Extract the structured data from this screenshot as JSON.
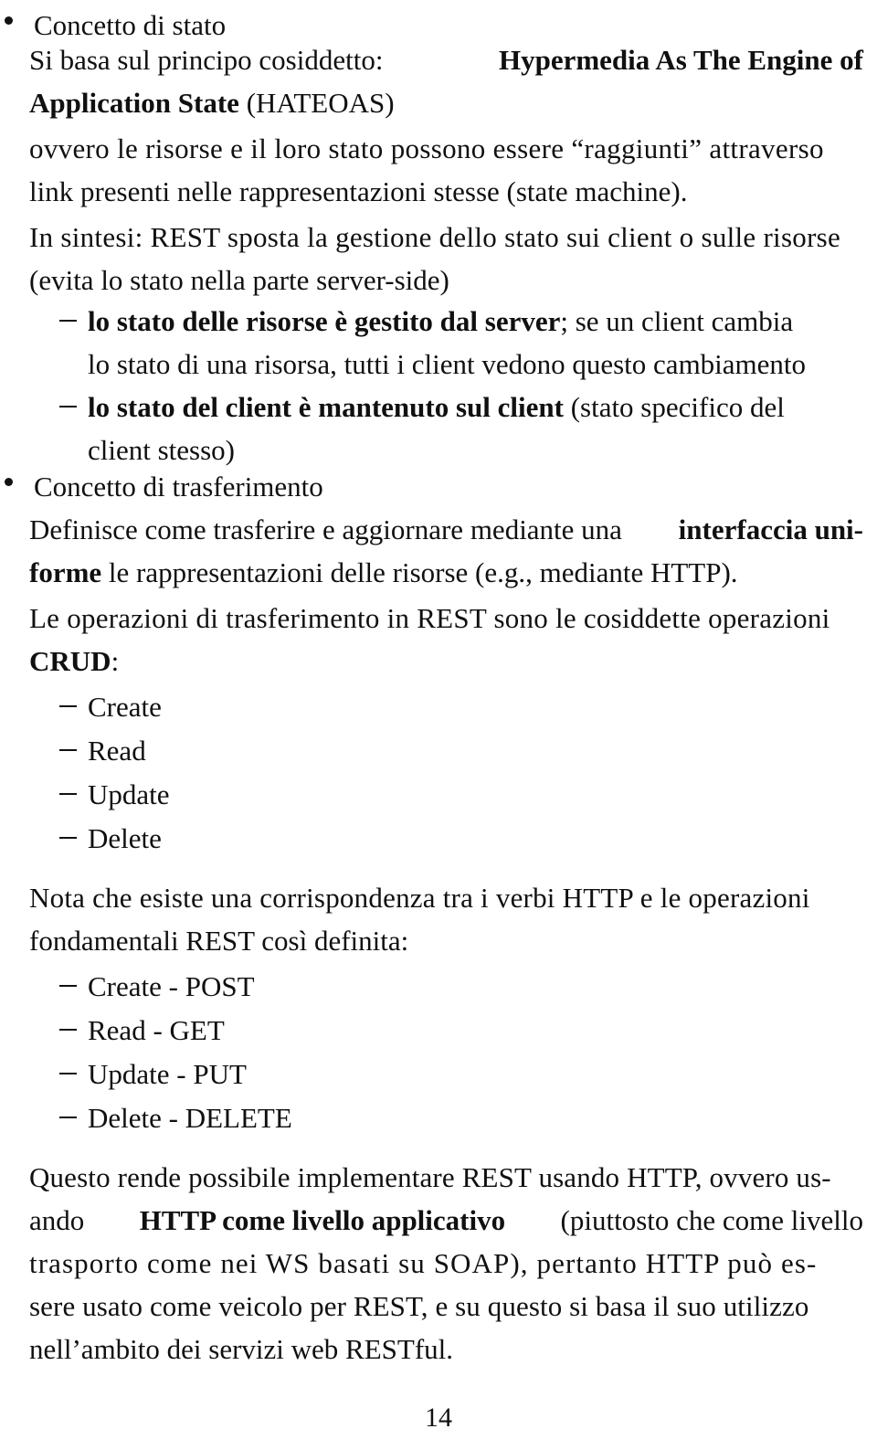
{
  "document": {
    "language": "it",
    "page_number": "14",
    "topic": "REST — Concetto di stato e Concetto di trasferimento"
  },
  "sections": [
    {
      "id": "concetto-di-stato",
      "bullet_label": "Concetto di stato",
      "lines": [
        {
          "id": "s1l1",
          "plain_a": "Si basa sul principo cosiddetto: ",
          "bold_b": "Hypermedia As The Engine of"
        },
        {
          "id": "s1l2",
          "bold_a": "Application State",
          "plain_b": " (HATEOAS)"
        }
      ],
      "paragraph2": [
        {
          "id": "s1p2l1",
          "text": "ovvero le risorse e il loro stato possono essere “raggiunti” attraverso"
        },
        {
          "id": "s1p2l2",
          "text": "link presenti nelle rappresentazioni stesse (state machine)."
        }
      ],
      "paragraph3": [
        {
          "id": "s1p3l1",
          "text": "In sintesi: REST sposta la gestione dello stato sui client o sulle risorse"
        },
        {
          "id": "s1p3l2",
          "text": "(evita lo stato nella parte server-side)"
        }
      ],
      "dash_items": [
        {
          "id": "d1",
          "line1_bold": "lo stato delle risorse è gestito dal server",
          "line1_plain": "; se un client cambia",
          "line2": "lo stato di una risorsa, tutti i client vedono questo cambiamento"
        },
        {
          "id": "d2",
          "line1_bold": "lo stato del client è mantenuto sul client",
          "line1_plain": " (stato specifico del",
          "line2": "client stesso)"
        }
      ]
    },
    {
      "id": "concetto-di-trasferimento",
      "bullet_label": "Concetto di trasferimento",
      "lines": [
        {
          "id": "s2l1",
          "plain_a": "Definisce come trasferire e aggiornare mediante una ",
          "bold_b": "interfaccia uni-"
        },
        {
          "id": "s2l2",
          "bold_a": "forme",
          "plain_b": " le rappresentazioni delle risorse (e.g., mediante HTTP)."
        }
      ],
      "paragraph2": [
        {
          "id": "s2p2l1",
          "text": "Le operazioni di trasferimento in REST sono le cosiddette operazioni"
        },
        {
          "id": "s2p2l2_bold",
          "text": "CRUD",
          "suffix": ":"
        }
      ],
      "crud_list": [
        {
          "id": "crud-create",
          "label": "Create"
        },
        {
          "id": "crud-read",
          "label": "Read"
        },
        {
          "id": "crud-update",
          "label": "Update"
        },
        {
          "id": "crud-delete",
          "label": "Delete"
        }
      ],
      "paragraph3": [
        {
          "id": "s2p3l1",
          "text": "Nota che esiste una corrispondenza tra i verbi HTTP e le operazioni"
        },
        {
          "id": "s2p3l2",
          "text": "fondamentali REST così definita:"
        }
      ],
      "verb_map_list": [
        {
          "id": "map-create",
          "label": "Create - POST"
        },
        {
          "id": "map-read",
          "label": "Read - GET"
        },
        {
          "id": "map-update",
          "label": "Update - PUT"
        },
        {
          "id": "map-delete",
          "label": "Delete - DELETE"
        }
      ],
      "closing_paragraph": [
        {
          "id": "cp1",
          "text": "Questo rende possibile implementare REST usando HTTP, ovvero us-"
        },
        {
          "id": "cp2_a",
          "text": "ando "
        },
        {
          "id": "cp2_bold",
          "text": "HTTP come livello applicativo"
        },
        {
          "id": "cp2_b",
          "text": " (piuttosto che come livello"
        },
        {
          "id": "cp3",
          "text": "trasporto come nei WS basati su SOAP), pertanto HTTP può es-"
        },
        {
          "id": "cp4",
          "text": "sere usato come veicolo per REST, e su questo si basa il suo utilizzo"
        },
        {
          "id": "cp5",
          "text": "nell’ambito dei servizi web RESTful."
        }
      ]
    }
  ],
  "colors": {
    "text": "#121212",
    "background": "#ffffff"
  }
}
